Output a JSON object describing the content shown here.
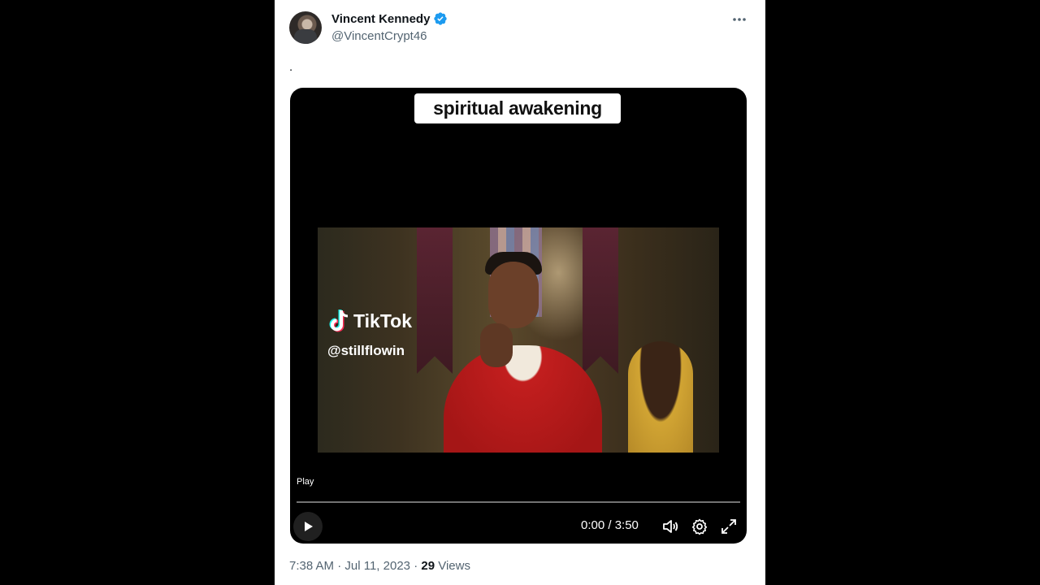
{
  "author": {
    "display_name": "Vincent Kennedy",
    "handle": "@VincentCrypt46",
    "verified": true
  },
  "tweet": {
    "text": "."
  },
  "video": {
    "caption": "spiritual awakening",
    "watermark_brand": "TikTok",
    "watermark_handle": "@stillflowin",
    "play_label": "Play",
    "time_readout": "0:00 / 3:50",
    "progress_fraction": 0.0
  },
  "meta": {
    "time": "7:38 AM",
    "date": "Jul 11, 2023",
    "separator": "·",
    "views_count": "29",
    "views_label": "Views"
  },
  "colors": {
    "verified_blue": "#1d9bf0",
    "secondary_text": "#536471",
    "primary_text": "#0f1419"
  }
}
